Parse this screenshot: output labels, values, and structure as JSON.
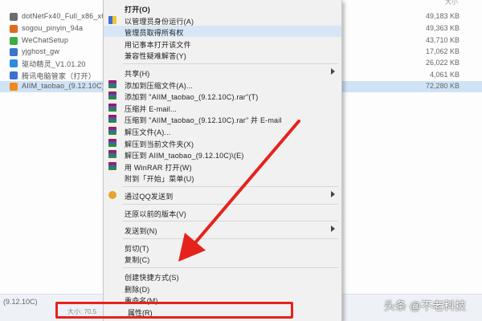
{
  "window": {
    "size_column_header": "大小"
  },
  "files": [
    {
      "name": "dotNetFx40_Full_x86_x64",
      "size": "49,183 KB",
      "icon_color": "#6d6d6d"
    },
    {
      "name": "sogou_pinyin_94a",
      "size": "49,363 KB",
      "icon_color": "#e06b1d"
    },
    {
      "name": "WeChatSetup",
      "size": "43,710 KB",
      "icon_color": "#3cae43"
    },
    {
      "name": "yjghost_gw",
      "size": "17,062 KB",
      "icon_color": "#3a76c9"
    },
    {
      "name": "驱动精灵_V1.01.20",
      "size": "26,022 KB",
      "icon_color": "#2a8fd8"
    },
    {
      "name": "腾讯电脑管家（打开）",
      "size": "4,061 KB",
      "icon_color": "#3f6fd0"
    },
    {
      "name": "AIIM_taobao_(9.12.10C)",
      "size": "72,280 KB",
      "icon_color": "#f08a1c",
      "selected": true
    }
  ],
  "status_bar": {
    "selected_name": "(9.12.10C)",
    "size_prefix": "大小: 70.5"
  },
  "context_menu": {
    "items": [
      {
        "label": "打开(O)",
        "icon": "",
        "bold": true
      },
      {
        "label": "以管理员身份运行(A)",
        "icon": "shield-icon"
      },
      {
        "label": "管理员取得所有权",
        "icon": "",
        "hover": true
      },
      {
        "label": "用记事本打开该文件",
        "icon": ""
      },
      {
        "label": "兼容性疑难解答(Y)",
        "icon": ""
      },
      {
        "sep": true
      },
      {
        "label": "共享(H)",
        "icon": "",
        "arrow": true
      },
      {
        "label": "添加到压缩文件(A)...",
        "icon": "rar-icon"
      },
      {
        "label": "添加到 \"AIIM_taobao_(9.12.10C).rar\"(T)",
        "icon": "rar-icon"
      },
      {
        "label": "压缩并 E-mail...",
        "icon": "rar-icon"
      },
      {
        "label": "压缩到 \"AIIM_taobao_(9.12.10C).rar\" 并 E-mail",
        "icon": "rar-icon"
      },
      {
        "label": "解压文件(A)...",
        "icon": "rar-icon"
      },
      {
        "label": "解压到当前文件夹(X)",
        "icon": "rar-icon"
      },
      {
        "label": "解压到 AIIM_taobao_(9.12.10C)\\(E)",
        "icon": "rar-icon"
      },
      {
        "label": "用 WinRAR 打开(W)",
        "icon": "rar-icon"
      },
      {
        "label": "附到「开始」菜单(U)",
        "icon": ""
      },
      {
        "sep": true
      },
      {
        "label": "通过QQ发送到",
        "icon": "qq-icon",
        "arrow": true
      },
      {
        "sep": true
      },
      {
        "label": "还原以前的版本(V)",
        "icon": ""
      },
      {
        "sep": true
      },
      {
        "label": "发送到(N)",
        "icon": "",
        "arrow": true
      },
      {
        "sep": true
      },
      {
        "label": "剪切(T)",
        "icon": ""
      },
      {
        "label": "复制(C)",
        "icon": ""
      },
      {
        "sep": true
      },
      {
        "label": "创建快捷方式(S)",
        "icon": ""
      },
      {
        "label": "删除(D)",
        "icon": ""
      },
      {
        "label": "重命名(M)",
        "icon": ""
      }
    ],
    "properties_label": "属性(R)"
  },
  "annotation": {
    "arrow_color": "#e5231c",
    "box_color": "#e5231c"
  },
  "watermark": {
    "text": "头条 @不老科技"
  }
}
